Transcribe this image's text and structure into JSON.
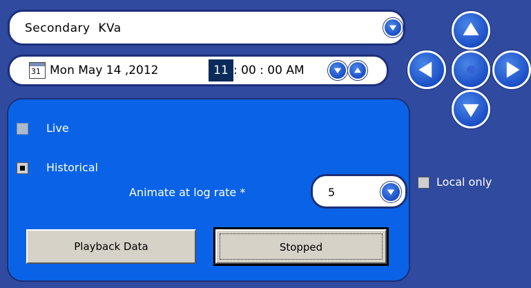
{
  "measurement_select": {
    "value": "Secondary  KVa"
  },
  "datetime": {
    "calendar_day": "31",
    "date": "Mon May 14 ,2012",
    "hour": "11",
    "rest": ": 00 : 00 AM"
  },
  "mode": {
    "live_label": "Live",
    "historical_label": "Historical",
    "selected": "Historical"
  },
  "animate": {
    "label": "Animate at log rate *",
    "value": "5"
  },
  "buttons": {
    "playback_label": "Playback Data",
    "stopped_label": "Stopped"
  },
  "local_only": {
    "label": "Local only",
    "checked": false
  },
  "colors": {
    "background": "#2f4a9e",
    "panel": "#0a63e6",
    "accent": "#1b4fc6"
  }
}
